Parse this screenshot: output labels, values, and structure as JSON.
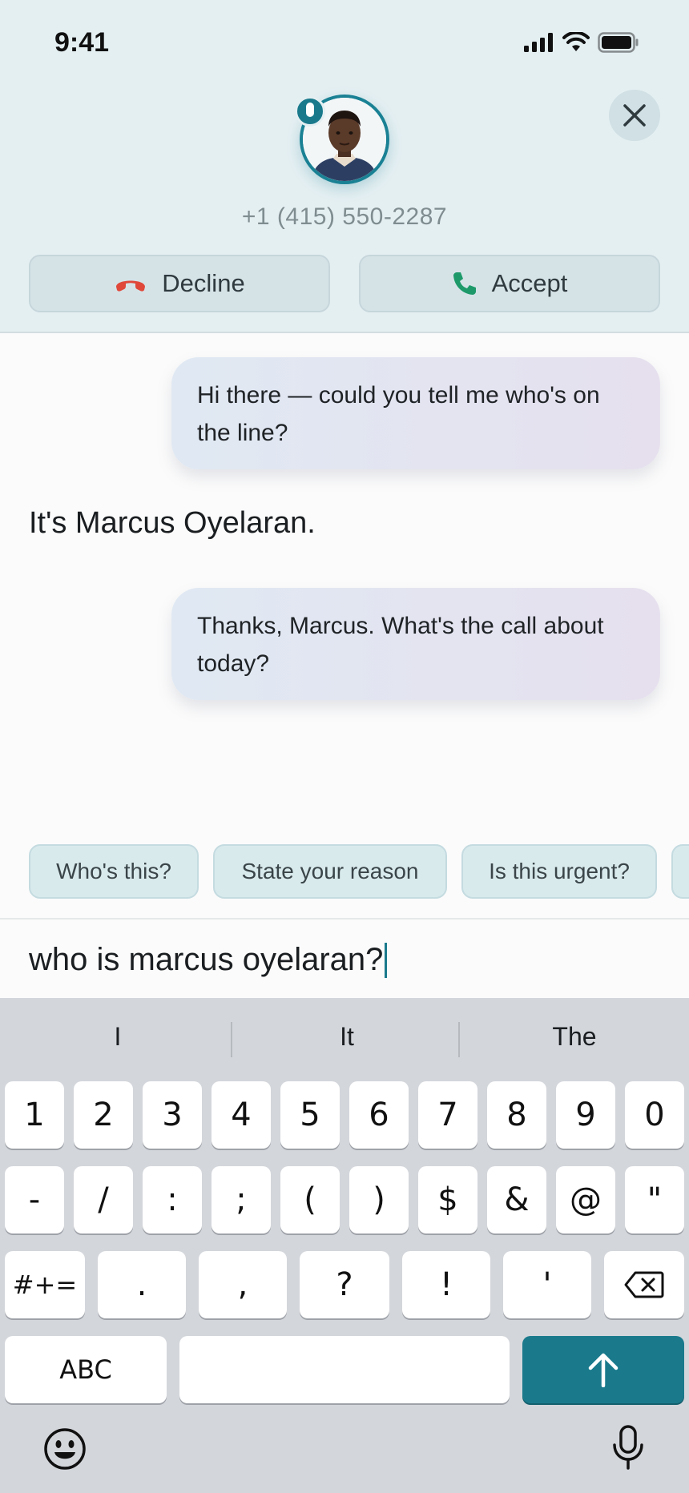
{
  "status_bar": {
    "time": "9:41",
    "icons": [
      "signal-icon",
      "wifi-icon",
      "battery-icon"
    ]
  },
  "call": {
    "caller_avatar": "caller-photo",
    "phone_number": "+1 (415) 550-2287",
    "decline_label": "Decline",
    "accept_label": "Accept",
    "colors": {
      "accent": "#1a7a8c",
      "decline": "#e0483a",
      "accept": "#1e9a6a"
    }
  },
  "conversation": {
    "messages": [
      {
        "from": "assistant",
        "text": "Hi there — could you tell me who's on the line?"
      },
      {
        "from": "caller",
        "text": "It's Marcus Oyelaran."
      },
      {
        "from": "assistant",
        "text": "Thanks, Marcus. What's the call about today?"
      }
    ]
  },
  "suggestions": [
    "Who's this?",
    "State your reason",
    "Is this urgent?"
  ],
  "input": {
    "value": "who is marcus oyelaran?"
  },
  "keyboard": {
    "predictions": [
      "I",
      "It",
      "The"
    ],
    "row1": [
      "1",
      "2",
      "3",
      "4",
      "5",
      "6",
      "7",
      "8",
      "9",
      "0"
    ],
    "row2": [
      "-",
      "/",
      ":",
      ";",
      "(",
      ")",
      "$",
      "&",
      "@",
      "\""
    ],
    "row3": [
      "#+=",
      ".",
      ",",
      "?",
      "!",
      "'"
    ],
    "abc_label": "ABC",
    "icons": [
      "backspace-icon",
      "send-arrow-icon",
      "emoji-icon",
      "microphone-icon"
    ]
  }
}
